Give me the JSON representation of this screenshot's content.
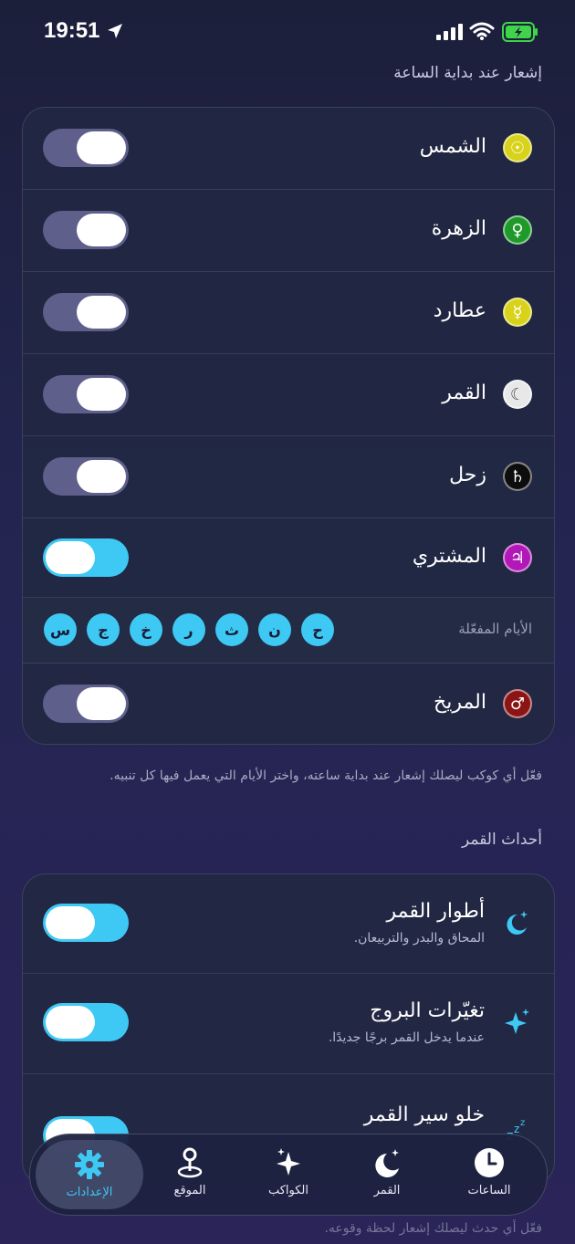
{
  "status": {
    "time": "19:51"
  },
  "hour_section": {
    "title": "إشعار عند بداية الساعة",
    "planets": [
      {
        "name": "الشمس",
        "icon": "sun-icon",
        "color": "#d8d21a",
        "on": false
      },
      {
        "name": "الزهرة",
        "icon": "venus-icon",
        "color": "#1f9a2a",
        "on": false
      },
      {
        "name": "عطارد",
        "icon": "mercury-icon",
        "color": "#d8d21a",
        "on": false
      },
      {
        "name": "القمر",
        "icon": "moon-icon",
        "color": "#e8e8e8",
        "on": false
      },
      {
        "name": "زحل",
        "icon": "saturn-icon",
        "color": "#0d0d0d",
        "on": false
      },
      {
        "name": "المشتري",
        "icon": "jupiter-icon",
        "color": "#b218b8",
        "on": true
      }
    ],
    "days_label": "الأيام المفعّلة",
    "days": [
      "ح",
      "ن",
      "ث",
      "ر",
      "خ",
      "ج",
      "س"
    ],
    "mars": {
      "name": "المريخ",
      "icon": "mars-icon",
      "color": "#8c1414",
      "on": false
    },
    "note": "فعّل أي كوكب ليصلك إشعار عند بداية ساعته، واختر الأيام التي يعمل فيها كل تنبيه."
  },
  "moon_section": {
    "title": "أحداث القمر",
    "events": [
      {
        "title": "أطوار القمر",
        "subtitle": "المحاق والبدر والتربيعان.",
        "icon": "moon-stars-icon",
        "on": true
      },
      {
        "title": "تغيّرات البروج",
        "subtitle": "عندما يدخل القمر برجًا جديدًا.",
        "icon": "sparkles-icon",
        "on": true
      },
      {
        "title": "خلو سير القمر",
        "subtitle": "",
        "icon": "zzz-icon",
        "on": true
      }
    ],
    "note": "فعّل أي حدث ليصلك إشعار لحظة وقوعه."
  },
  "tabs": [
    {
      "label": "الساعات",
      "icon": "clock-icon",
      "active": false
    },
    {
      "label": "القمر",
      "icon": "moon-tab-icon",
      "active": false
    },
    {
      "label": "الكواكب",
      "icon": "stars-tab-icon",
      "active": false
    },
    {
      "label": "الموقع",
      "icon": "map-pin-icon",
      "active": false
    },
    {
      "label": "الإعدادات",
      "icon": "gear-icon",
      "active": true
    }
  ],
  "colors": {
    "accent": "#3ec8f4",
    "toggle_off": "#5e5f8a",
    "battery": "#3fd44a"
  }
}
